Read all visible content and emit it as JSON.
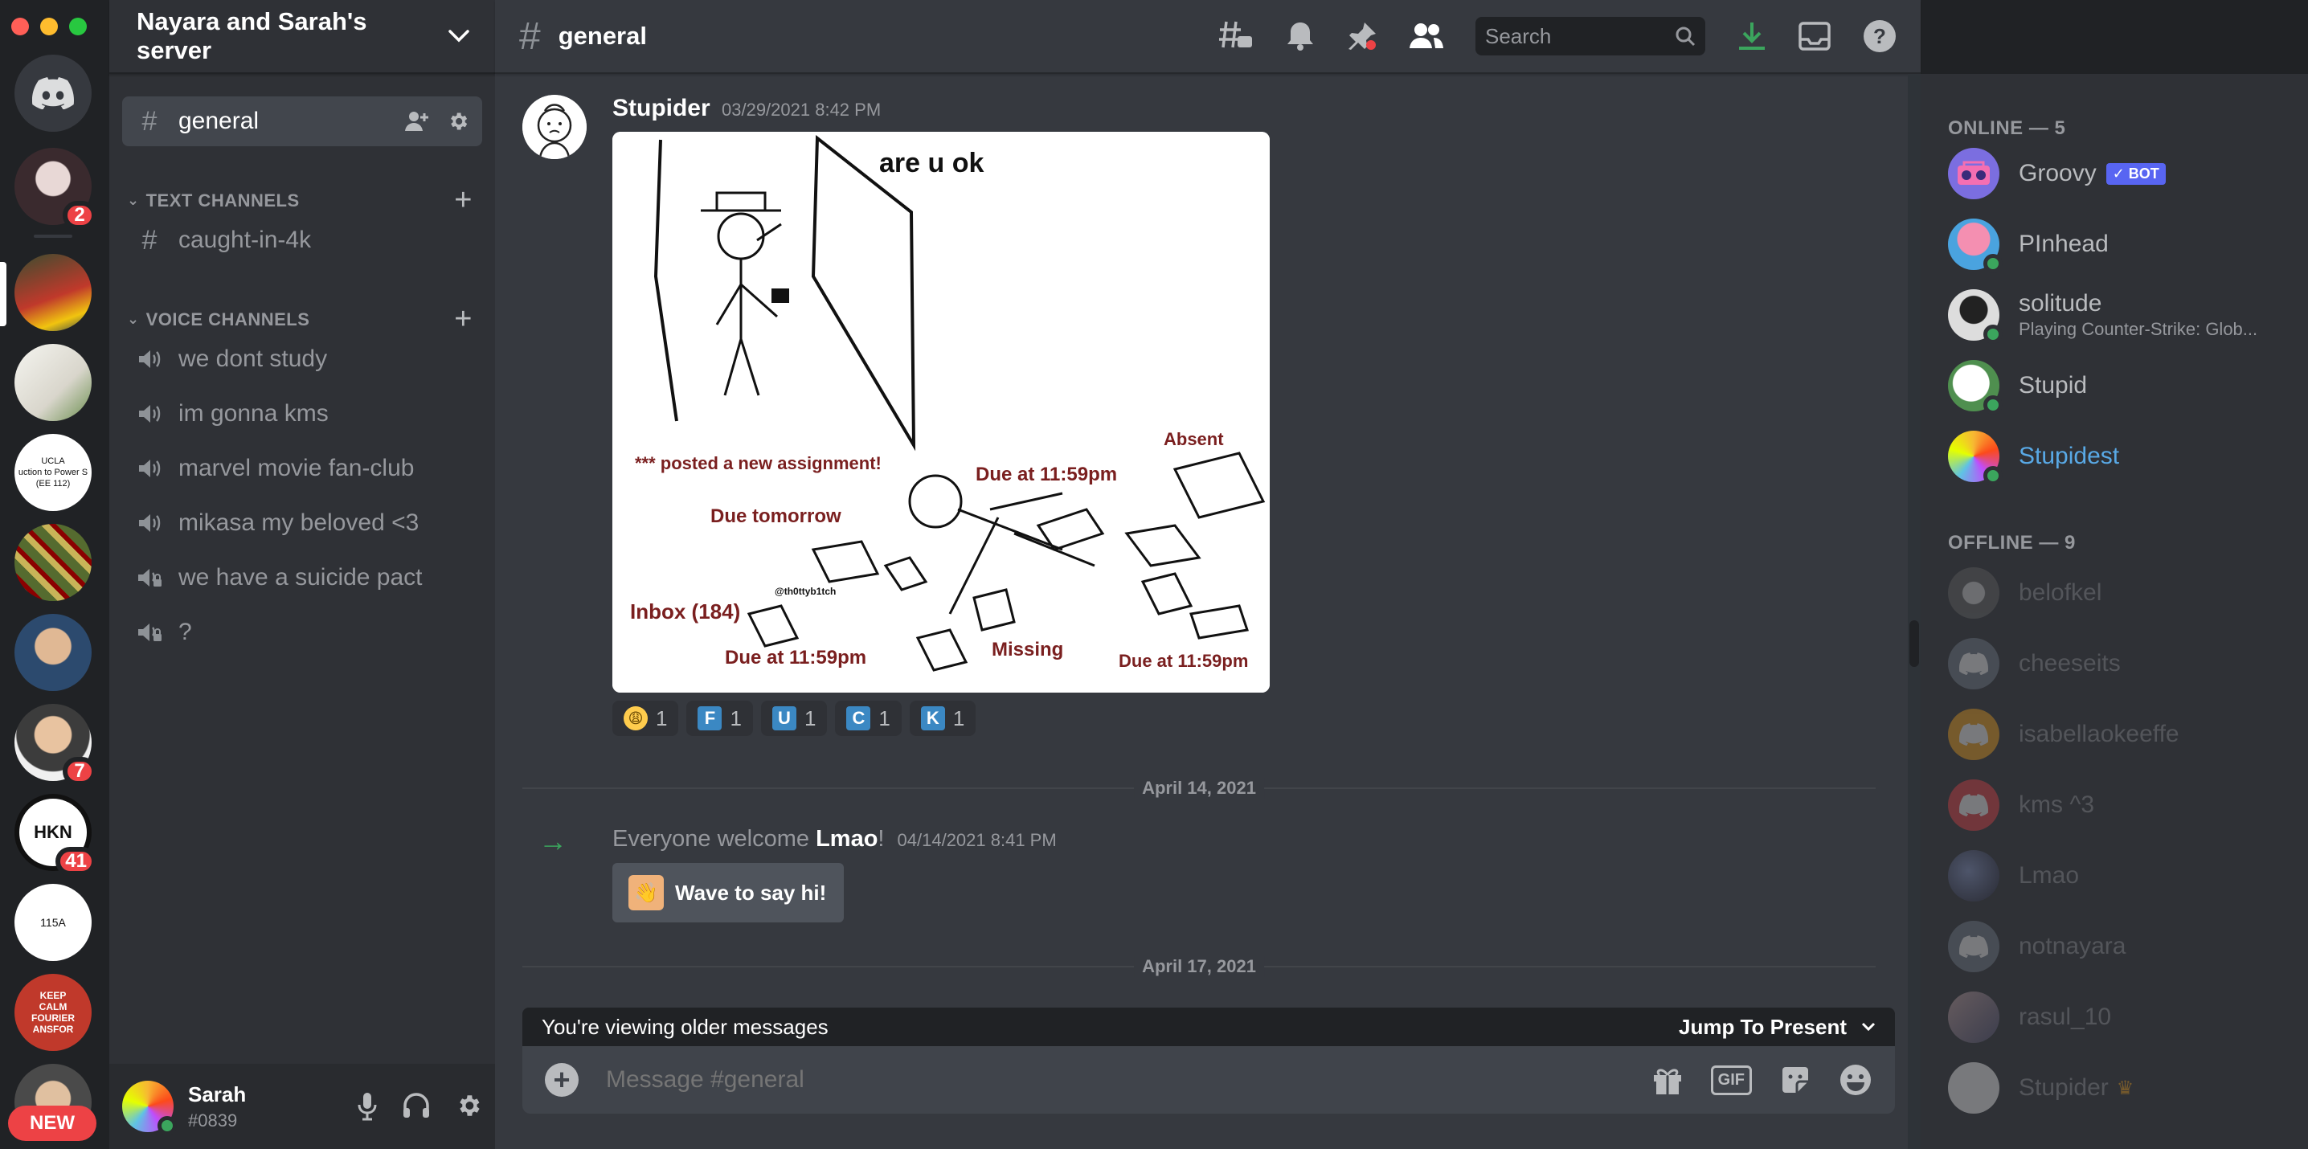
{
  "server": {
    "name": "Nayara and Sarah's server"
  },
  "rail": {
    "badges": [
      "2",
      "7",
      "41"
    ],
    "ucla_text": "UCLA\nuction to Power S\n(EE 112)",
    "hkn_text": "HKN",
    "amp_text": "115A",
    "keep_calm_text": "KEEP\nCALM\nFOURIER\nANSFOR",
    "new_label": "NEW"
  },
  "channels": {
    "selected": "general",
    "text_category": "TEXT CHANNELS",
    "text": [
      "caught-in-4k"
    ],
    "voice_category": "VOICE CHANNELS",
    "voice": [
      "we dont study",
      "im gonna kms",
      "marvel movie fan-club",
      "mikasa my beloved <3",
      "we have a suicide pact",
      "?"
    ]
  },
  "user": {
    "name": "Sarah",
    "tag": "#0839"
  },
  "header": {
    "channel": "general",
    "search_placeholder": "Search"
  },
  "message": {
    "author": "Stupider",
    "timestamp": "03/29/2021 8:42 PM",
    "meme": {
      "title": "are u ok",
      "labels": [
        "*** posted a new assignment!",
        "Absent",
        "Due at 11:59pm",
        "Due tomorrow",
        "@th0ttyb1tch",
        "Inbox (184)",
        "Due at 11:59pm",
        "Missing",
        "Due at 11:59pm"
      ]
    },
    "reactions": [
      {
        "emoji": "😩",
        "count": "1"
      },
      {
        "letter": "F",
        "count": "1"
      },
      {
        "letter": "U",
        "count": "1"
      },
      {
        "letter": "C",
        "count": "1"
      },
      {
        "letter": "K",
        "count": "1"
      }
    ]
  },
  "dividers": [
    "April 14, 2021",
    "April 17, 2021"
  ],
  "system": {
    "prefix": "Everyone welcome",
    "name": "Lmao",
    "suffix": "!",
    "time": "04/14/2021 8:41 PM",
    "wave_label": "Wave to say hi!"
  },
  "older_bar": {
    "text": "You're viewing older messages",
    "jump": "Jump To Present"
  },
  "composer": {
    "placeholder": "Message #general",
    "gif": "GIF"
  },
  "members": {
    "online_header": "ONLINE — 5",
    "online": [
      {
        "name": "Groovy",
        "badge": "✓ BOT"
      },
      {
        "name": "PInhead"
      },
      {
        "name": "solitude",
        "activity": "Playing Counter-Strike: Glob..."
      },
      {
        "name": "Stupid"
      },
      {
        "name": "Stupidest"
      }
    ],
    "offline_header": "OFFLINE — 9",
    "offline": [
      "belofkel",
      "cheeseits",
      "isabellaokeeffe",
      "kms ^3",
      "Lmao",
      "notnayara",
      "rasul_10",
      "Stupider"
    ]
  },
  "colors": {
    "accent": "#5865f2",
    "online": "#3ba55d",
    "mention": "#ed4245",
    "stupidest": "#59a9e6"
  }
}
